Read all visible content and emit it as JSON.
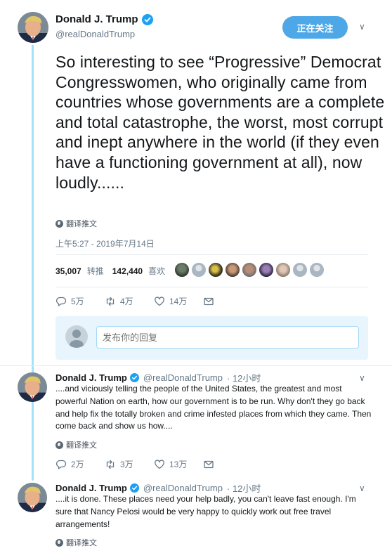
{
  "main_tweet": {
    "author_name": "Donald J. Trump",
    "handle": "@realDonaldTrump",
    "follow_label": "正在关注",
    "text": "So interesting to see “Progressive” Democrat Congresswomen, who originally came from countries whose governments are a complete and total catastrophe, the worst, most corrupt and inept anywhere in the world (if they even have a functioning government at all), now loudly......",
    "translate_label": "翻译推文",
    "timestamp": "上午5:27 - 2019年7月14日",
    "retweets_count": "35,007",
    "retweets_label": "转推",
    "likes_count": "142,440",
    "likes_label": "喜欢",
    "replies": "5万",
    "retweets_short": "4万",
    "likes_short": "14万"
  },
  "reply_box": {
    "placeholder": "发布你的回复"
  },
  "thread": [
    {
      "author_name": "Donald J. Trump",
      "handle": "@realDonaldTrump",
      "time": "· 12小时",
      "text": "....and viciously telling the people of the United States, the greatest and most powerful Nation on earth, how our government is to be run. Why don't they go back and help fix the totally broken and crime infested places from which they came. Then come back and show us how....",
      "translate_label": "翻译推文",
      "replies": "2万",
      "retweets": "3万",
      "likes": "13万"
    },
    {
      "author_name": "Donald J. Trump",
      "handle": "@realDonaldTrump",
      "time": "· 12小时",
      "text": "....it is done. These places need your help badly, you can't leave fast enough. I'm sure that Nancy Pelosi would be very happy to quickly work out free travel arrangements!",
      "translate_label": "翻译推文"
    }
  ],
  "colors": {
    "accent": "#1da1f2",
    "follow_button": "#4ea8e8",
    "thread_line": "#a3e2f8",
    "secondary_text": "#657786"
  },
  "icons": [
    "verified-badge-icon",
    "chevron-down-icon",
    "globe-icon",
    "reply-icon",
    "retweet-icon",
    "like-icon",
    "message-icon"
  ]
}
